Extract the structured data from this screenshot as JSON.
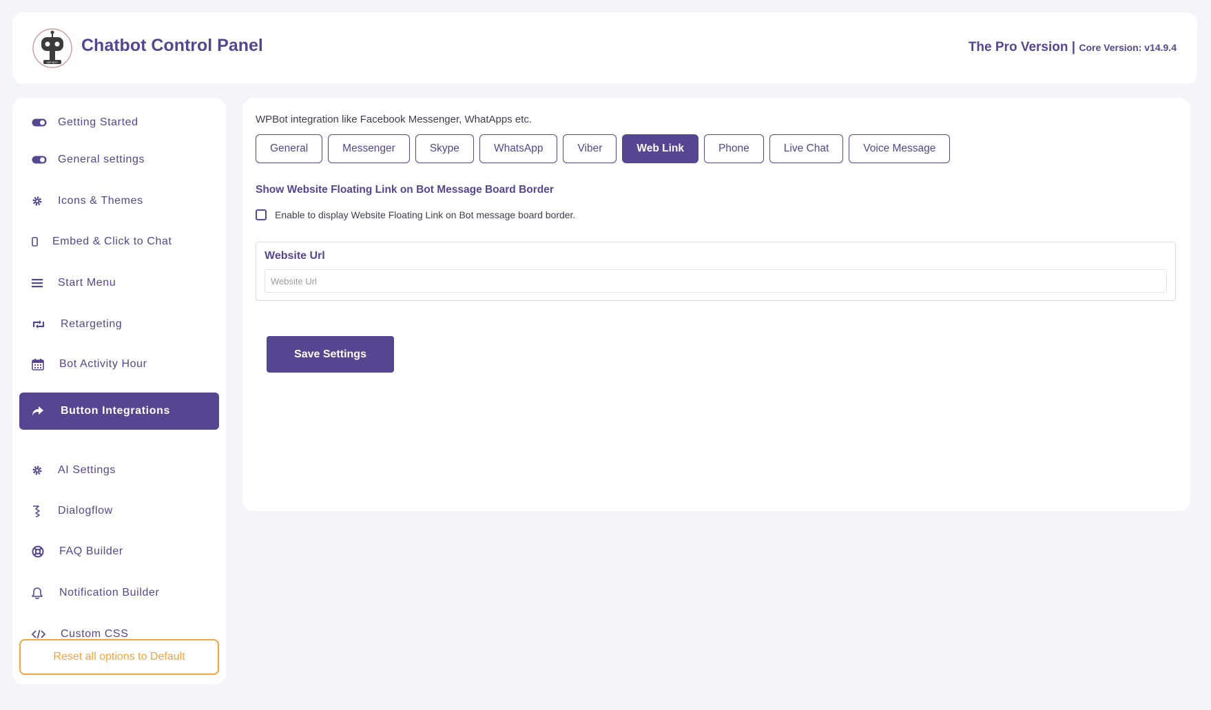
{
  "header": {
    "title": "Chatbot Control Panel",
    "logo_text": "WP BOT",
    "pro_version": "The Pro Version |",
    "core_version": "Core Version: v14.9.4"
  },
  "sidebar": {
    "items": [
      {
        "label": "Getting Started",
        "icon": "toggle-icon",
        "active": false
      },
      {
        "label": "General settings",
        "icon": "toggle-icon",
        "active": false
      },
      {
        "label": "Icons & Themes",
        "icon": "gear-icon",
        "active": false
      },
      {
        "label": "Embed & Click to Chat",
        "icon": "mobile-icon",
        "active": false
      },
      {
        "label": "Start Menu",
        "icon": "menu-icon",
        "active": false
      },
      {
        "label": "Retargeting",
        "icon": "retweet-icon",
        "active": false
      },
      {
        "label": "Bot Activity Hour",
        "icon": "calendar-icon",
        "active": false
      },
      {
        "label": "Button Integrations",
        "icon": "share-icon",
        "active": true
      },
      {
        "label": "AI Settings",
        "icon": "gear-icon",
        "active": false
      },
      {
        "label": "Dialogflow",
        "icon": "dialogflow-icon",
        "active": false
      },
      {
        "label": "FAQ Builder",
        "icon": "lifebuoy-icon",
        "active": false
      },
      {
        "label": "Notification Builder",
        "icon": "bell-icon",
        "active": false
      },
      {
        "label": "Custom CSS",
        "icon": "code-icon",
        "active": false
      }
    ],
    "reset_label": "Reset all options to Default"
  },
  "main": {
    "intro": "WPBot integration like Facebook Messenger, WhatApps etc.",
    "tabs": [
      {
        "label": "General",
        "active": false
      },
      {
        "label": "Messenger",
        "active": false
      },
      {
        "label": "Skype",
        "active": false
      },
      {
        "label": "WhatsApp",
        "active": false
      },
      {
        "label": "Viber",
        "active": false
      },
      {
        "label": "Web Link",
        "active": true
      },
      {
        "label": "Phone",
        "active": false
      },
      {
        "label": "Live Chat",
        "active": false
      },
      {
        "label": "Voice Message",
        "active": false
      }
    ],
    "section_title": "Show Website Floating Link on Bot Message Board Border",
    "checkbox_label": "Enable to display Website Floating Link on Bot message board border.",
    "checkbox_checked": false,
    "url_label": "Website Url",
    "url_value": "",
    "url_placeholder": "Website Url",
    "save_label": "Save Settings"
  },
  "colors": {
    "accent": "#564590",
    "reset": "#f5a33c",
    "background": "#f4f5fb"
  }
}
